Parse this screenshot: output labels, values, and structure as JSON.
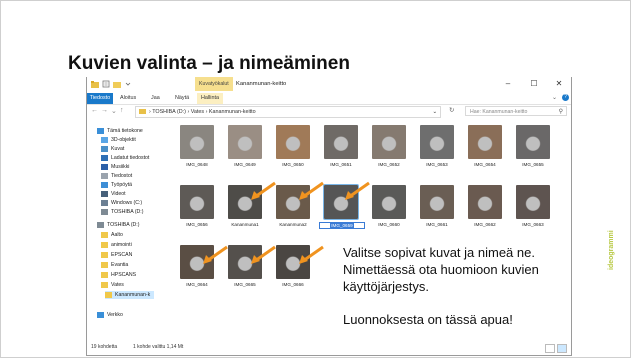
{
  "slide": {
    "title": "Kuvien valinta – ja nimeäminen",
    "callout_lines": [
      "Valitse sopivat kuvat ja nimeä ne.",
      "Nimettäessä ota huomioon kuvien",
      "käyttöjärjestys.",
      "Luonnoksesta on tässä apua!"
    ],
    "brand": "ideogrammi",
    "brand_color": "#b7c842"
  },
  "window": {
    "context_tab": "Kuvatyökalut",
    "title": "Kananmunan-keitto",
    "minimize": "–",
    "maximize": "☐",
    "close": "✕"
  },
  "ribbon": {
    "tabs": [
      "Tiedosto",
      "Aloitus",
      "Jaa",
      "Näytä",
      "Hallinta"
    ],
    "expand": "⌄",
    "help": "?",
    "accent": "#1979ca"
  },
  "address": {
    "back": "←",
    "forward": "→",
    "recent": "⌄",
    "up": "↑",
    "path": "› TOSHIBA (D:) › Vates › Kananmunan-keitto",
    "dropdown": "⌄",
    "refresh": "↻",
    "search_placeholder": "Hae: Kananmunan-keitto",
    "search_icon": "⚲"
  },
  "nav": {
    "items": [
      {
        "label": "Tämä tietokone",
        "icon": "pc-icon"
      },
      {
        "label": "3D-objektit",
        "icon": "cube-icon"
      },
      {
        "label": "Kuvat",
        "icon": "pictures-icon"
      },
      {
        "label": "Ladatut tiedostot",
        "icon": "download-icon"
      },
      {
        "label": "Musiikki",
        "icon": "music-icon"
      },
      {
        "label": "Tiedostot",
        "icon": "documents-icon"
      },
      {
        "label": "Työpöytä",
        "icon": "desktop-icon"
      },
      {
        "label": "Videot",
        "icon": "video-icon"
      },
      {
        "label": "Windows (C:)",
        "icon": "drive-icon"
      },
      {
        "label": "TOSHIBA (D:)",
        "icon": "drive-icon"
      },
      {
        "label": "TOSHIBA (D:)",
        "icon": "drive-icon"
      },
      {
        "label": "Aalto",
        "icon": "folder-icon"
      },
      {
        "label": "animointi",
        "icon": "folder-icon"
      },
      {
        "label": "EPSCAN",
        "icon": "folder-icon"
      },
      {
        "label": "Evantia",
        "icon": "folder-icon"
      },
      {
        "label": "HPSCANS",
        "icon": "folder-icon"
      },
      {
        "label": "Vates",
        "icon": "folder-icon"
      },
      {
        "label": "Kananmunan-k",
        "icon": "folder-icon"
      },
      {
        "label": "Verkko",
        "icon": "network-icon"
      }
    ]
  },
  "files": [
    {
      "name": "IMG_0648",
      "color": "#8a8680"
    },
    {
      "name": "IMG_0649",
      "color": "#9a8e84"
    },
    {
      "name": "IMG_0650",
      "color": "#a07a58"
    },
    {
      "name": "IMG_0651",
      "color": "#6f6a66"
    },
    {
      "name": "IMG_0652",
      "color": "#857a70"
    },
    {
      "name": "IMG_0653",
      "color": "#6e6e6e"
    },
    {
      "name": "IMG_0654",
      "color": "#8a6e58"
    },
    {
      "name": "IMG_0655",
      "color": "#6a6868"
    },
    {
      "name": "IMG_0656",
      "color": "#5e5a56"
    },
    {
      "name": "Kananmuna1",
      "color": "#4e4c48"
    },
    {
      "name": "Kananmuna2",
      "color": "#6a5a4a"
    },
    {
      "name": "IMG_0659",
      "color": "#555555"
    },
    {
      "name": "IMG_0660",
      "color": "#5a5a58"
    },
    {
      "name": "IMG_0661",
      "color": "#6a5e54"
    },
    {
      "name": "IMG_0662",
      "color": "#6a5a50"
    },
    {
      "name": "IMG_0663",
      "color": "#5e5450"
    },
    {
      "name": "IMG_0664",
      "color": "#5a4e44"
    },
    {
      "name": "IMG_0665",
      "color": "#54504c"
    },
    {
      "name": "IMG_0666",
      "color": "#4a4642"
    }
  ],
  "arrow_color": "#f0931f",
  "status": {
    "count": "19 kohdetta",
    "selection": "1 kohde valittu 1,14 Mt"
  }
}
